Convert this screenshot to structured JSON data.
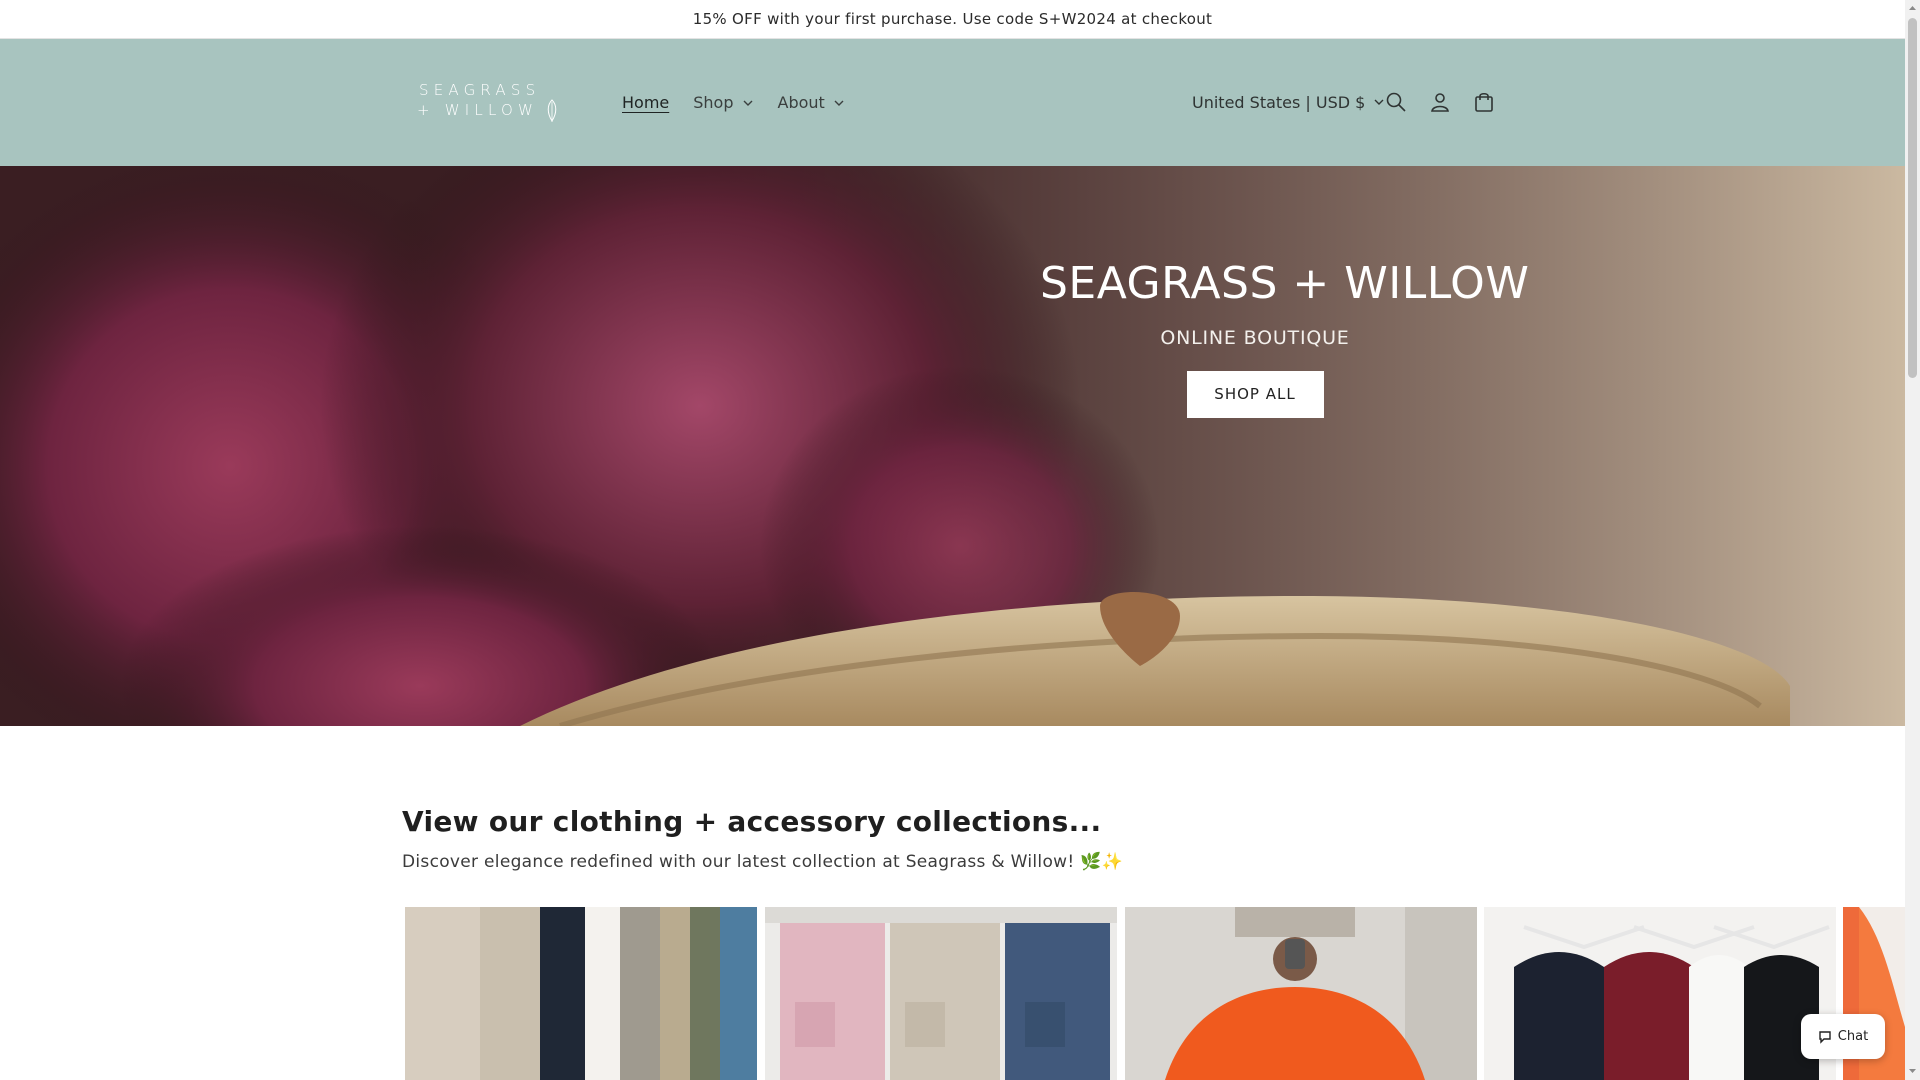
{
  "announcement": "15% OFF with your first purchase. Use code S+W2024 at checkout",
  "logo": {
    "line1": "SEAGRASS",
    "line2": "+ WILLOW"
  },
  "nav": {
    "home": "Home",
    "shop": "Shop",
    "about": "About"
  },
  "header": {
    "country_selector": "United States | USD $",
    "icons": [
      "search-icon",
      "account-icon",
      "cart-icon"
    ]
  },
  "hero": {
    "title": "SEAGRASS + WILLOW",
    "subtitle": "ONLINE BOUTIQUE",
    "button": "SHOP ALL"
  },
  "collections": {
    "heading": "View our clothing + accessory collections...",
    "description": "Discover elegance redefined with our latest collection at Seagrass & Willow! 🌿✨"
  },
  "chat": {
    "label": "Chat"
  },
  "colors": {
    "header_bg": "#a8c4bf",
    "announcement_bg": "#ffffff",
    "button_bg": "#ffffff"
  }
}
